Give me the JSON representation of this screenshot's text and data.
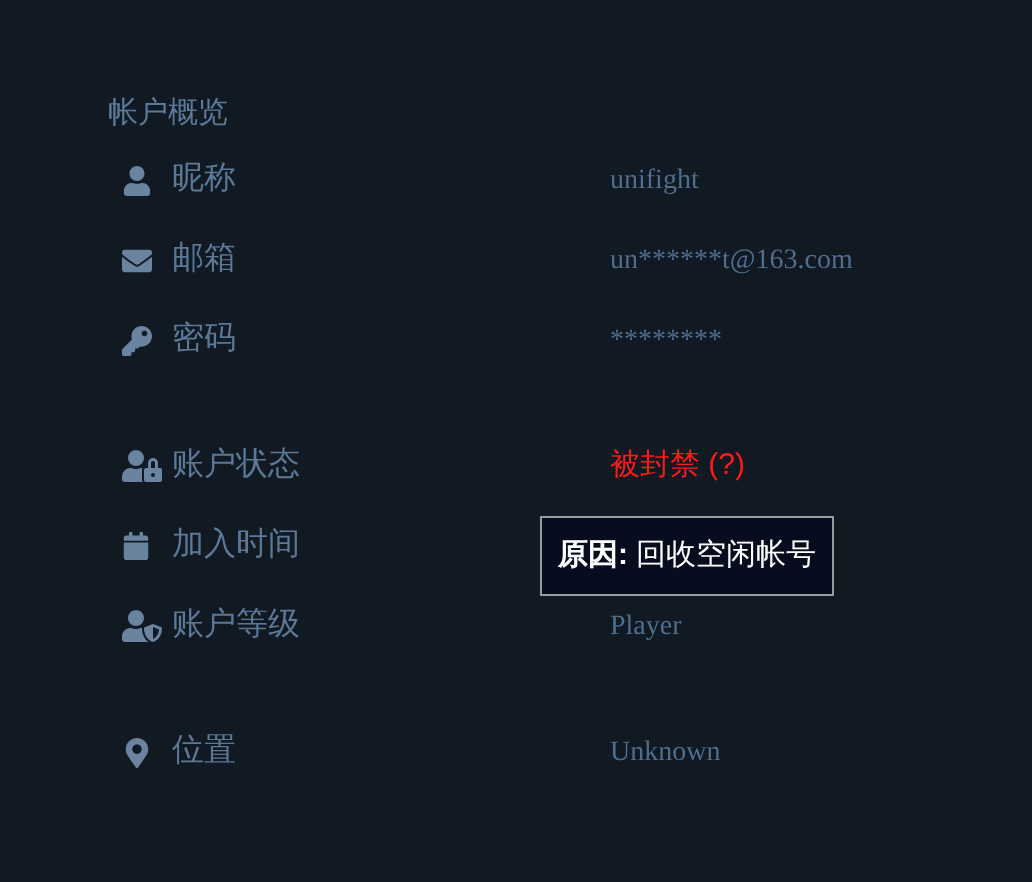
{
  "section_title": "帐户概览",
  "groups": [
    [
      {
        "label": "昵称",
        "value": "unifight",
        "kind": "plain"
      },
      {
        "label": "邮箱",
        "value": "un******t@163.com",
        "kind": "plain"
      },
      {
        "label": "密码",
        "value": "********",
        "kind": "plain"
      }
    ],
    [
      {
        "label": "账户状态",
        "value": "被封禁 (?)",
        "kind": "alert"
      },
      {
        "label": "加入时间",
        "tooltip": "**原因:** 回收空闲帐号"
      },
      {
        "label": "账户等级",
        "value": "Player",
        "kind": "plain"
      }
    ],
    [
      {
        "label": "位置",
        "value": "Unknown",
        "kind": "plain"
      }
    ]
  ]
}
